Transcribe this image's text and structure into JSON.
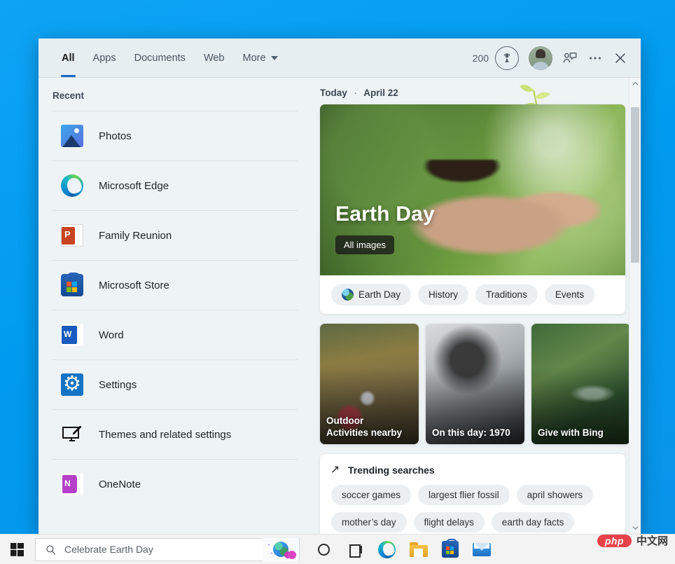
{
  "desktop": {
    "background_color": "#0098f0"
  },
  "panel": {
    "tabs": [
      {
        "label": "All",
        "active": true
      },
      {
        "label": "Apps",
        "active": false
      },
      {
        "label": "Documents",
        "active": false
      },
      {
        "label": "Web",
        "active": false
      },
      {
        "label": "More",
        "active": false,
        "has_caret": true
      }
    ],
    "accent_color": "#1668c5",
    "header_actions": {
      "rewards_count": "200",
      "rewards_icon": "rewards-medal-icon",
      "avatar_icon": "user-avatar",
      "feedback_icon": "feedback-person-icon",
      "more_icon": "ellipsis-icon",
      "close_icon": "close-icon"
    }
  },
  "recent": {
    "title": "Recent",
    "items": [
      {
        "label": "Photos",
        "icon": "photos-app-icon"
      },
      {
        "label": "Microsoft Edge",
        "icon": "edge-app-icon"
      },
      {
        "label": "Family Reunion",
        "icon": "powerpoint-file-icon"
      },
      {
        "label": "Microsoft Store",
        "icon": "microsoft-store-icon"
      },
      {
        "label": "Word",
        "icon": "word-app-icon"
      },
      {
        "label": "Settings",
        "icon": "settings-app-icon"
      },
      {
        "label": "Themes and related settings",
        "icon": "themes-monitor-brush-icon"
      },
      {
        "label": "OneNote",
        "icon": "onenote-app-icon"
      }
    ]
  },
  "feed": {
    "today_label": "Today",
    "separator": "·",
    "date": "April 22",
    "hero": {
      "title": "Earth Day",
      "badge": "All images",
      "chips": [
        {
          "label": "Earth Day",
          "icon": "globe-icon"
        },
        {
          "label": "History"
        },
        {
          "label": "Traditions"
        },
        {
          "label": "Events"
        }
      ]
    },
    "tiles": [
      {
        "line1": "Outdoor",
        "line2": "Activities nearby"
      },
      {
        "line1": "On this day: 1970",
        "line2": ""
      },
      {
        "line1": "Give with Bing",
        "line2": ""
      }
    ],
    "trending": {
      "heading": "Trending searches",
      "icon": "trending-arrow-icon",
      "chips": [
        "soccer games",
        "largest flier fossil",
        "april showers",
        "mother’s day",
        "flight delays",
        "earth day facts"
      ]
    },
    "scrollbar": {
      "up_icon": "chevron-up-icon",
      "down_icon": "chevron-down-icon"
    }
  },
  "taskbar": {
    "start_icon": "windows-start-icon",
    "search": {
      "icon": "search-icon",
      "value": "",
      "placeholder": "Celebrate Earth Day",
      "badge_icon": "earth-day-bing-icon"
    },
    "icons": [
      {
        "name": "cortana-icon"
      },
      {
        "name": "task-view-icon"
      },
      {
        "name": "edge-taskbar-icon"
      },
      {
        "name": "file-explorer-icon"
      },
      {
        "name": "microsoft-store-taskbar-icon"
      },
      {
        "name": "mail-taskbar-icon"
      }
    ]
  },
  "watermark": {
    "logo_text": "php",
    "text": "中文网"
  }
}
